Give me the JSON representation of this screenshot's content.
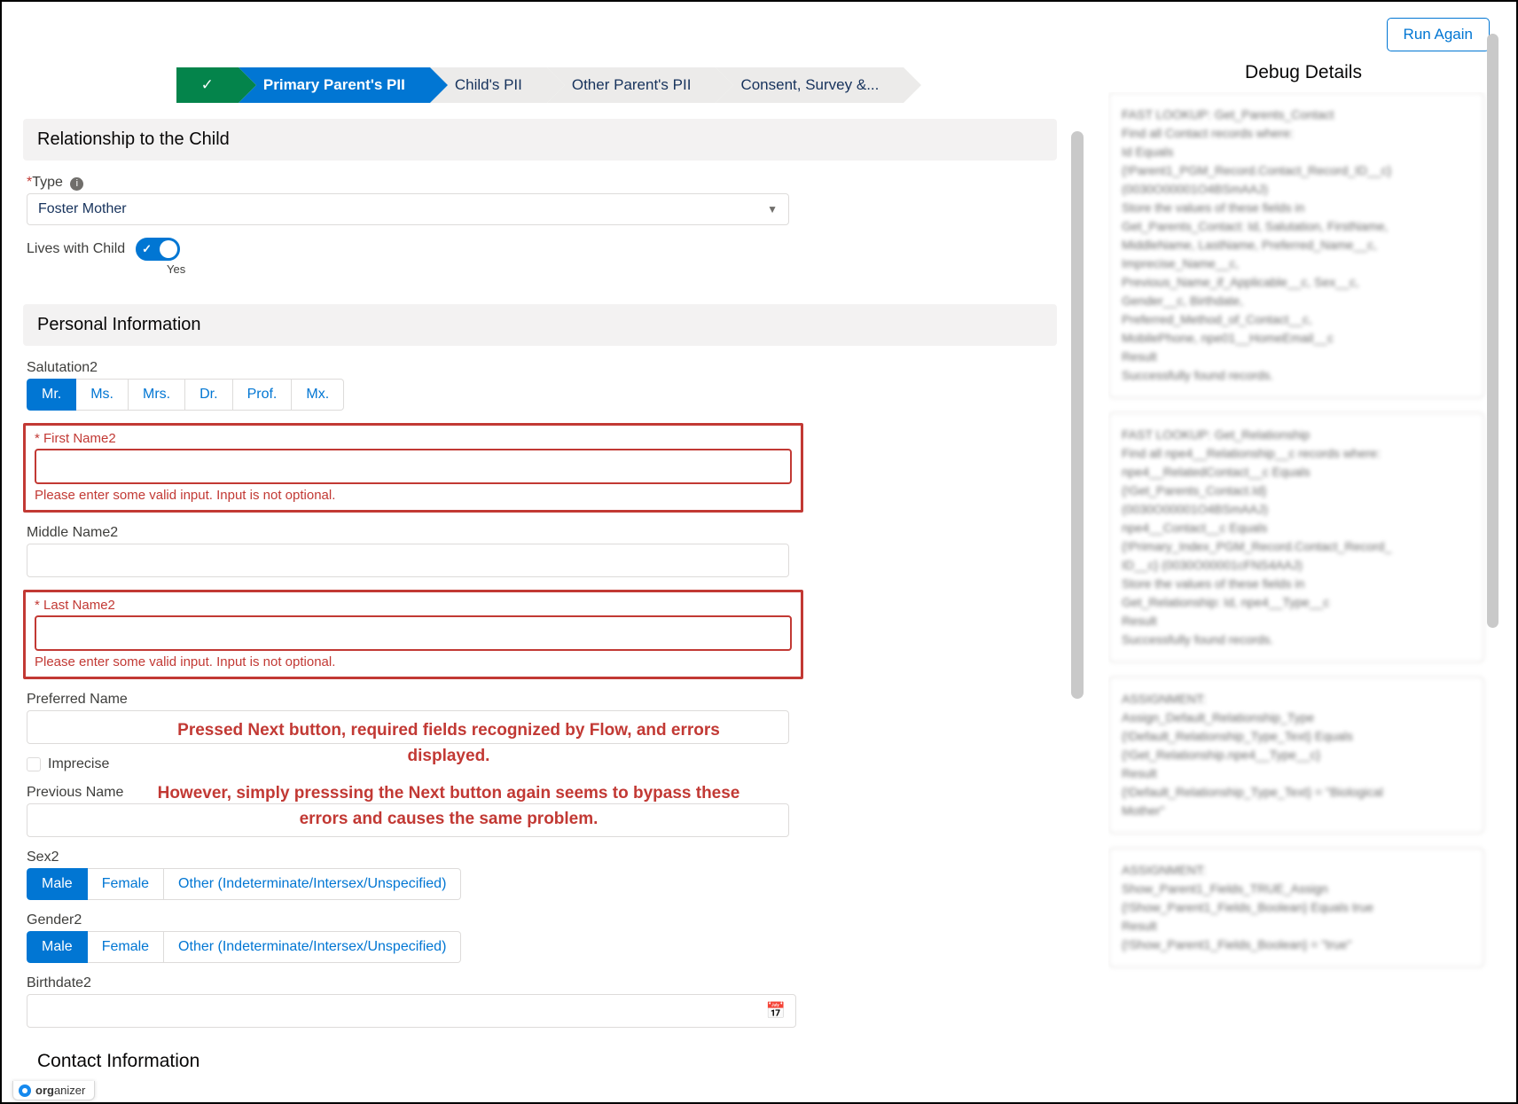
{
  "topbar": {
    "run_again": "Run Again"
  },
  "stepper": {
    "done_icon": "✓",
    "s1": "Primary Parent's PII",
    "s2": "Child's PII",
    "s3": "Other Parent's PII",
    "s4": "Consent, Survey &..."
  },
  "sections": {
    "relationship": "Relationship to the Child",
    "personal": "Personal Information",
    "contact": "Contact Information"
  },
  "fields": {
    "type_label": "Type",
    "type_value": "Foster Mother",
    "lives_label": "Lives with Child",
    "lives_yes": "Yes",
    "salutation_label": "Salutation2",
    "salutations": {
      "mr": "Mr.",
      "ms": "Ms.",
      "mrs": "Mrs.",
      "dr": "Dr.",
      "prof": "Prof.",
      "mx": "Mx."
    },
    "first_name_label": "First Name2",
    "middle_name_label": "Middle Name2",
    "last_name_label": "Last Name2",
    "preferred_name_label": "Preferred Name",
    "imprecise_label": "Imprecise",
    "previous_name_label": "Previous Name",
    "error_msg": "Please enter some valid input. Input is not optional.",
    "sex_label": "Sex2",
    "gender_label": "Gender2",
    "birthdate_label": "Birthdate2",
    "sex_opts": {
      "male": "Male",
      "female": "Female",
      "other": "Other (Indeterminate/Intersex/Unspecified)"
    }
  },
  "annotation": {
    "l1": "Pressed Next button, required fields recognized by Flow, and errors displayed.",
    "l2": "However, simply presssing the Next button again seems to bypass these errors and causes the same problem."
  },
  "debug": {
    "title": "Debug Details",
    "c1": "FAST LOOKUP: Get_Parents_Contact\nFind all Contact records where:\nId Equals\n{!Parent1_PGM_Record.Contact_Record_ID__c}\n(0030O00001O4BSmAAJ)\nStore the values of these fields in\nGet_Parents_Contact: Id, Salutation, FirstName,\nMiddleName, LastName, Preferred_Name__c,\nImprecise_Name__c,\nPrevious_Name_if_Applicable__c, Sex__c,\nGender__c, Birthdate,\nPreferred_Method_of_Contact__c,\nMobilePhone, npe01__HomeEmail__c\nResult\nSuccessfully found records.",
    "c2": "FAST LOOKUP: Get_Relationship\nFind all npe4__Relationship__c records where:\nnpe4__RelatedContact__c Equals\n{!Get_Parents_Contact.Id}\n(0030O00001O4BSmAAJ)\nnpe4__Contact__c Equals\n{!Primary_Index_PGM_Record.Contact_Record_\nID__c} (0030O00001cFNS4AAJ)\nStore the values of these fields in\nGet_Relationship: Id, npe4__Type__c\nResult\nSuccessfully found records.",
    "c3": "ASSIGNMENT:\nAssign_Default_Relationship_Type\n{!Default_Relationship_Type_Text} Equals\n{!Get_Relationship.npe4__Type__c}\nResult\n{!Default_Relationship_Type_Text} = \"Biological\nMother\"",
    "c4": "ASSIGNMENT:\nShow_Parent1_Fields_TRUE_Assign\n{!Show_Parent1_Fields_Boolean} Equals true\nResult\n{!Show_Parent1_Fields_Boolean} = \"true\""
  },
  "badge": {
    "prefix": "org",
    "suffix": "anizer"
  }
}
